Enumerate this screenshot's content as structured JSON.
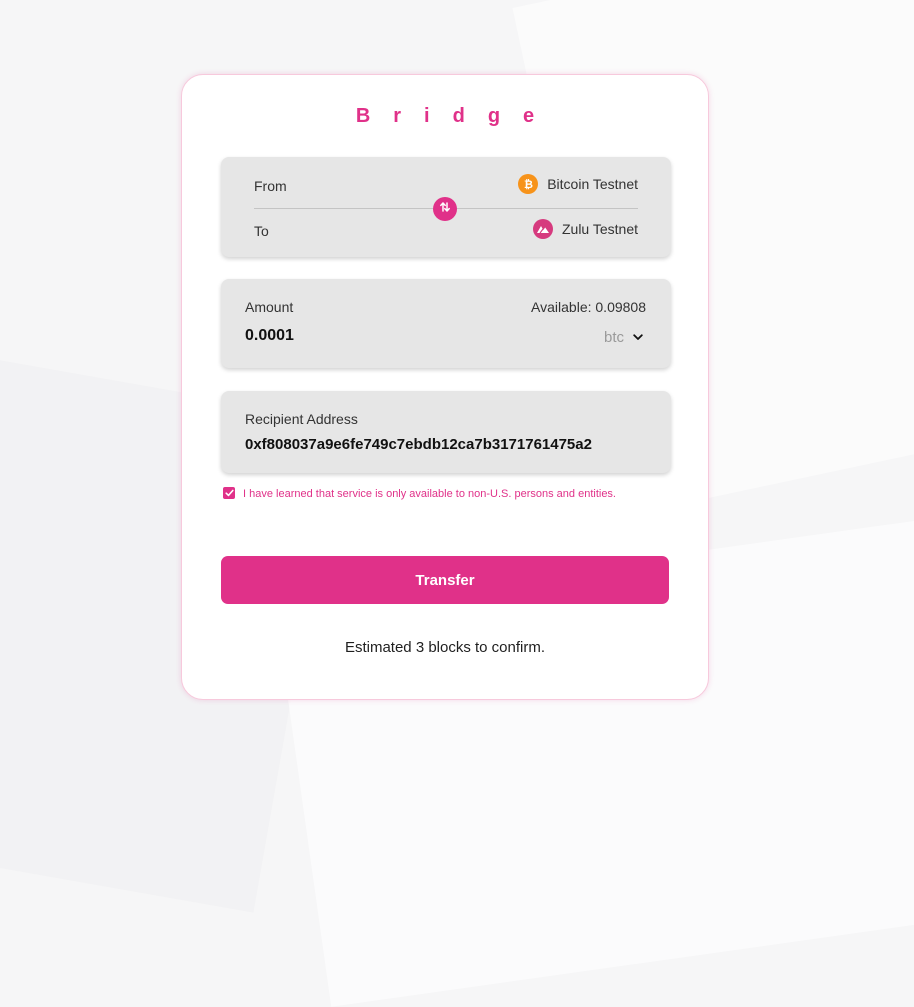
{
  "bridge": {
    "title": "Bridge",
    "route": {
      "from_label": "From",
      "to_label": "To",
      "from_network": "Bitcoin Testnet",
      "to_network": "Zulu Testnet",
      "from_icon": "bitcoin-icon",
      "to_icon": "zulu-icon",
      "swap_icon": "swap-arrows-icon"
    },
    "amount": {
      "label": "Amount",
      "available": "Available: 0.09808",
      "value": "0.0001",
      "token": "btc",
      "token_icon": "chevron-down-icon"
    },
    "recipient": {
      "label": "Recipient Address",
      "value": "0xf808037a9e6fe749c7ebdb12ca7b3171761475a2"
    },
    "agreement": {
      "checked": true,
      "text": "I have learned that service is only available to non-U.S. persons and entities."
    },
    "transfer_label": "Transfer",
    "estimate": "Estimated 3 blocks to confirm."
  },
  "colors": {
    "accent": "#e03189",
    "panel": "#e6e6e6",
    "bitcoin": "#f7931a",
    "zulu": "#d63a7e"
  }
}
